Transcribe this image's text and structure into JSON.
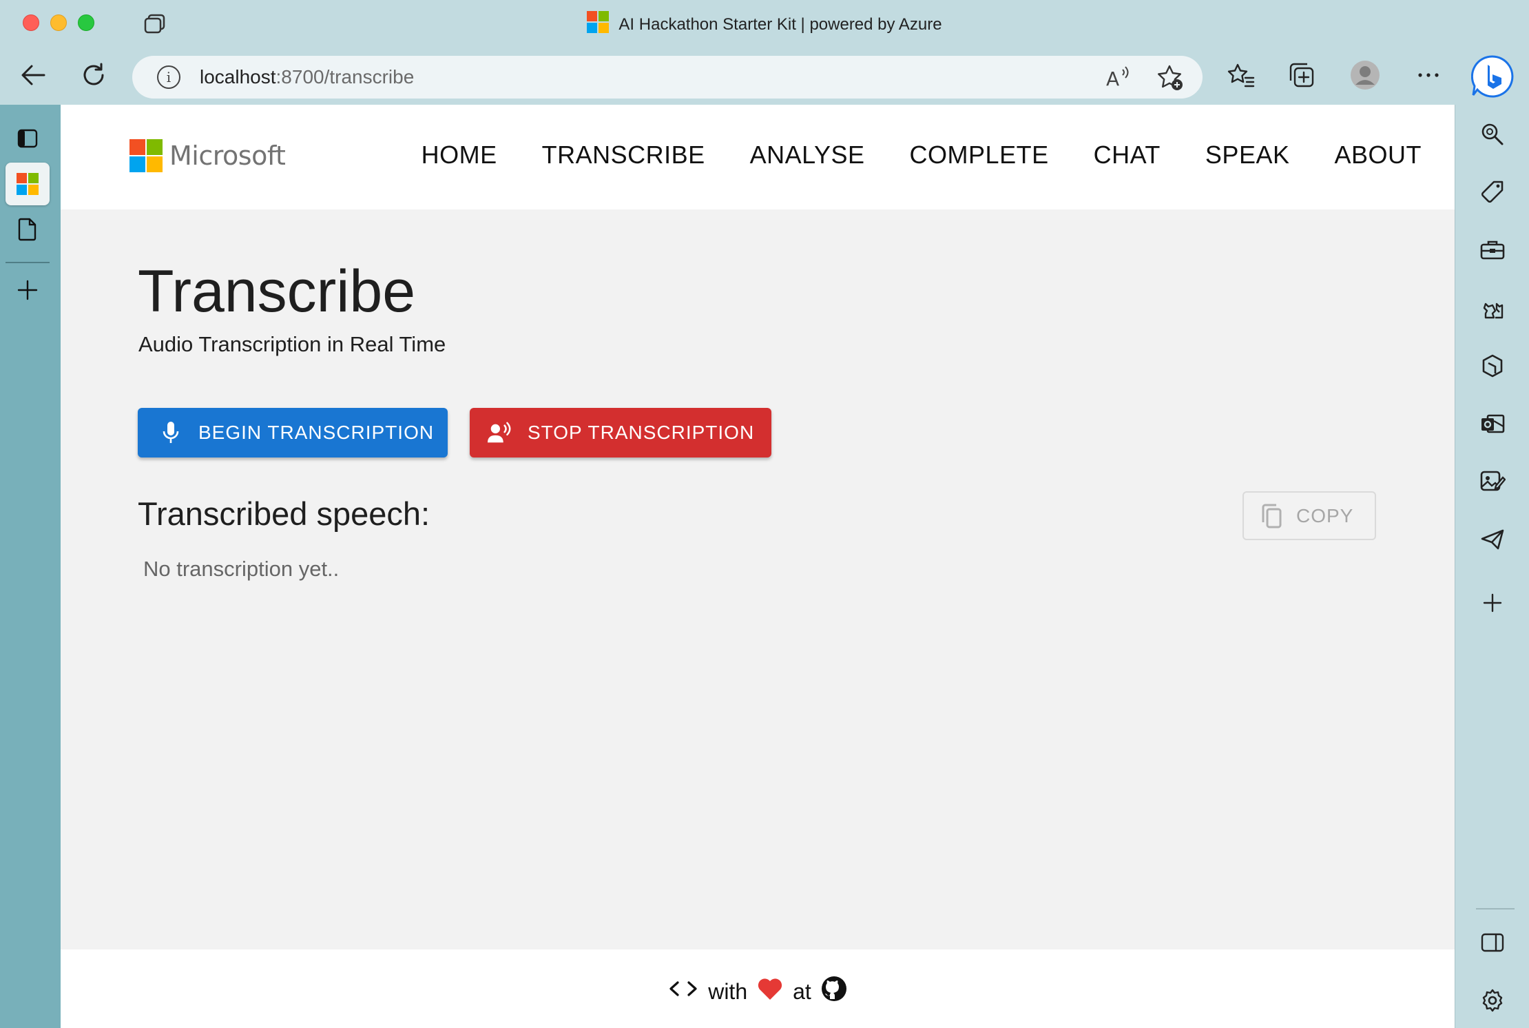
{
  "browser": {
    "window_title": "AI Hackathon Starter Kit | powered by Azure",
    "url_host": "localhost",
    "url_rest": ":8700/transcribe"
  },
  "site": {
    "logo_text": "Microsoft",
    "nav": [
      "HOME",
      "TRANSCRIBE",
      "ANALYSE",
      "COMPLETE",
      "CHAT",
      "SPEAK",
      "ABOUT"
    ]
  },
  "main": {
    "title": "Transcribe",
    "subtitle": "Audio Transcription in Real Time",
    "begin_label": "BEGIN TRANSCRIPTION",
    "stop_label": "STOP TRANSCRIPTION",
    "speech_heading": "Transcribed speech:",
    "copy_label": "COPY",
    "empty_text": "No transcription yet.."
  },
  "footer": {
    "with_text": "with",
    "at_text": "at"
  },
  "colors": {
    "primary": "#1976d2",
    "danger": "#d32f2f",
    "heart": "#e53935",
    "page_bg": "#f2f2f2"
  },
  "icons": {
    "right_sidebar": [
      "search-icon",
      "tag-icon",
      "toolbox-icon",
      "games-icon",
      "office-icon",
      "outlook-icon",
      "designer-icon",
      "send-icon",
      "plus-icon",
      "sidebar-toggle-icon",
      "settings-icon"
    ]
  }
}
